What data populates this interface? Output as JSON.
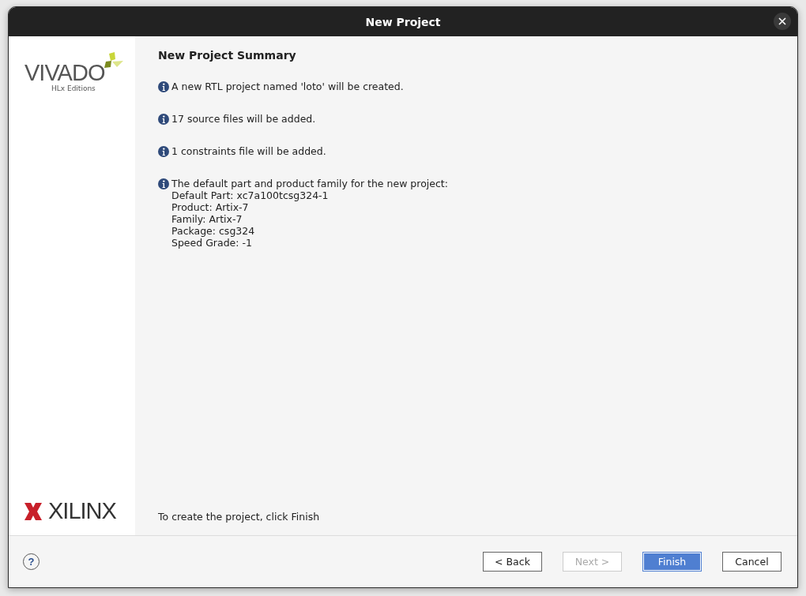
{
  "window": {
    "title": "New Project"
  },
  "sidebar": {
    "top_logo": {
      "name": "VIVADO",
      "subtitle": "HLx Editions"
    },
    "bottom_logo": {
      "name": "XILINX"
    }
  },
  "page": {
    "heading": "New Project Summary",
    "messages": [
      {
        "lines": [
          "A new RTL project named 'loto' will be created."
        ]
      },
      {
        "lines": [
          "17 source files will be added."
        ]
      },
      {
        "lines": [
          "1 constraints file will be added."
        ]
      },
      {
        "lines": [
          "The default part and product family for the new project:",
          "Default Part: xc7a100tcsg324-1",
          "Product: Artix-7",
          "Family: Artix-7",
          "Package: csg324",
          "Speed Grade: -1"
        ]
      }
    ],
    "footer_text": "To create the project, click Finish"
  },
  "help_button": {
    "label": "?"
  },
  "buttons": [
    {
      "label": "< Back",
      "disabled": false,
      "default": false
    },
    {
      "label": "Next >",
      "disabled": true,
      "default": false
    },
    {
      "label": "Finish",
      "disabled": false,
      "default": true
    },
    {
      "label": "Cancel",
      "disabled": false,
      "default": false
    }
  ]
}
